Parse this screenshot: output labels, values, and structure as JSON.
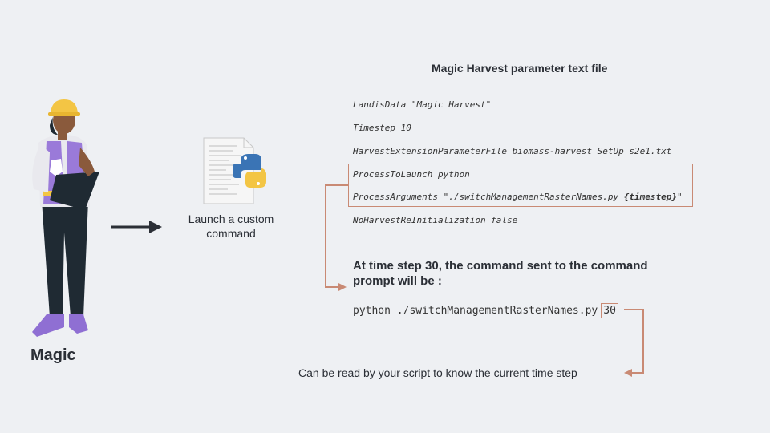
{
  "character": {
    "name": "Magic"
  },
  "launch": {
    "label": "Launch a custom command",
    "icon": "python-script-icon"
  },
  "parameter_file": {
    "title": "Magic Harvest parameter text file",
    "lines": [
      "LandisData \"Magic Harvest\"",
      "Timestep 10",
      "HarvestExtensionParameterFile biomass-harvest_SetUp_s2e1.txt",
      "ProcessToLaunch python"
    ],
    "process_arguments_prefix": "ProcessArguments \"./switchManagementRasterNames.py ",
    "process_arguments_token": "{timestep}",
    "process_arguments_suffix": "\"",
    "last_line": "NoHarvestReInitialization false"
  },
  "result": {
    "heading": "At time step 30, the command sent to the command prompt will be :",
    "command": "python ./switchManagementRasterNames.py",
    "timestep_value": "30"
  },
  "note": "Can be read by your script to know the current time step",
  "colors": {
    "accent": "#c98a74",
    "arrow_dark": "#2b2f36",
    "background": "#eef0f3"
  }
}
